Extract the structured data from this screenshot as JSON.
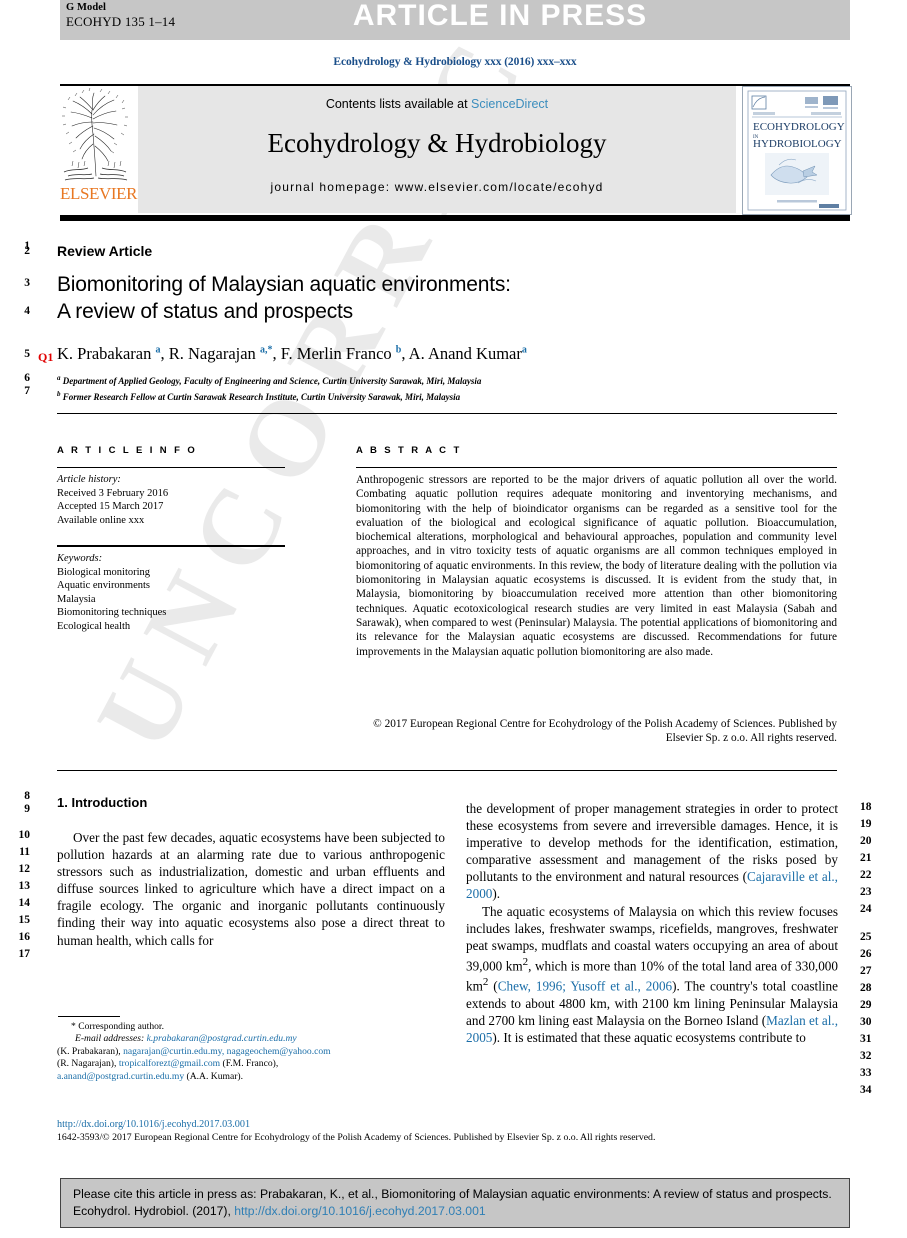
{
  "banner": {
    "g_model_line1": "G Model",
    "g_model_line2": "ECOHYD 135 1–14",
    "article_in_press": "ARTICLE IN PRESS"
  },
  "journal_ref": "Ecohydrology & Hydrobiology xxx (2016) xxx–xxx",
  "masthead": {
    "contents_prefix": "Contents lists available at ",
    "sciencedirect": "ScienceDirect",
    "journal_title": "Ecohydrology & Hydrobiology",
    "homepage": "journal homepage: www.elsevier.com/locate/ecohyd",
    "publisher_wordmark": "ELSEVIER",
    "cover_title_line1": "ECOHYDROLOGY",
    "cover_title_mid": "IN",
    "cover_title_line2": "HYDROBIOLOGY"
  },
  "article": {
    "type_label": "Review Article",
    "title_line1": "Biomonitoring of Malaysian aquatic environments:",
    "title_line2": "A review of status and prospects",
    "query_tag": "Q1",
    "authors_html": "K. Prabakaran <sup>a</sup>, R. Nagarajan <sup>a,*</sup>, F. Merlin Franco <sup>b</sup>, A. Anand Kumar<sup>a</sup>",
    "affiliation_a": "Department of Applied Geology, Faculty of Engineering and Science, Curtin University Sarawak, Miri, Malaysia",
    "affiliation_b": "Former Research Fellow at Curtin Sarawak Research Institute, Curtin University Sarawak, Miri, Malaysia"
  },
  "article_info": {
    "heading": "A R T I C L E   I N F O",
    "history_heading": "Article history:",
    "received": "Received 3 February 2016",
    "accepted": "Accepted 15 March 2017",
    "available": "Available online xxx",
    "keywords_heading": "Keywords:",
    "keywords": [
      "Biological monitoring",
      "Aquatic environments",
      "Malaysia",
      "Biomonitoring techniques",
      "Ecological health"
    ]
  },
  "abstract": {
    "heading": "A B S T R A C T",
    "text": "Anthropogenic stressors are reported to be the major drivers of aquatic pollution all over the world. Combating aquatic pollution requires adequate monitoring and inventorying mechanisms, and biomonitoring with the help of bioindicator organisms can be regarded as a sensitive tool for the evaluation of the biological and ecological significance of aquatic pollution. Bioaccumulation, biochemical alterations, morphological and behavioural approaches, population and community level approaches, and in vitro toxicity tests of aquatic organisms are all common techniques employed in biomonitoring of aquatic environments. In this review, the body of literature dealing with the pollution via biomonitoring in Malaysian aquatic ecosystems is discussed. It is evident from the study that, in Malaysia, biomonitoring by bioaccumulation received more attention than other biomonitoring techniques. Aquatic ecotoxicological research studies are very limited in east Malaysia (Sabah and Sarawak), when compared to west (Peninsular) Malaysia. The potential applications of biomonitoring and its relevance for the Malaysian aquatic ecosystems are discussed. Recommendations for future improvements in the Malaysian aquatic pollution biomonitoring are also made.",
    "copyright": "© 2017 European Regional Centre for Ecohydrology of the Polish Academy of Sciences. Published by Elsevier Sp. z o.o. All rights reserved."
  },
  "body": {
    "section_heading": "1. Introduction",
    "left_paragraph_1": "Over the past few decades, aquatic ecosystems have been subjected to pollution hazards at an alarming rate due to various anthropogenic stressors such as industrialization, domestic and urban effluents and diffuse sources linked to agriculture which have a direct impact on a fragile ecology. The organic and inorganic pollutants continuously finding their way into aquatic ecosystems also pose a direct threat to human health, which calls for",
    "right_paragraph_1_pre": "the development of proper management strategies in order to protect these ecosystems from severe and irreversible damages. Hence, it is imperative to develop methods for the identification, estimation, comparative assessment and management of the risks posed by pollutants to the environment and natural resources (",
    "right_paragraph_1_ref": "Cajaraville et al., 2000",
    "right_paragraph_1_post": ").",
    "right_paragraph_2_a": "The aquatic ecosystems of Malaysia on which this review focuses includes lakes, freshwater swamps, ricefields, mangroves, freshwater peat swamps, mudflats and coastal waters occupying an area of about 39,000 km",
    "right_paragraph_2_b": ", which is more than 10% of the total land area of 330,000 km",
    "right_paragraph_2_ref1": "Chew, 1996; Yusoff et al., 2006",
    "right_paragraph_2_c": "). The country's total coastline extends to about 4800 km, with 2100 km lining Peninsular Malaysia and 2700 km lining east Malaysia on the Borneo Island (",
    "right_paragraph_2_ref2": "Mazlan et al., 2005",
    "right_paragraph_2_d": "). It is estimated that these aquatic ecosystems contribute to"
  },
  "line_numbers_left": [
    "1",
    "2",
    "3",
    "4",
    "5",
    "6",
    "7",
    "8",
    "9",
    "10",
    "11",
    "12",
    "13",
    "14",
    "15",
    "16",
    "17"
  ],
  "line_numbers_right": [
    "18",
    "19",
    "20",
    "21",
    "22",
    "23",
    "24",
    "25",
    "26",
    "27",
    "28",
    "29",
    "30",
    "31",
    "32",
    "33",
    "34"
  ],
  "footnotes": {
    "corresponding": "* Corresponding author.",
    "emails_heading": "E-mail addresses:",
    "email_1": "k.prabakaran@postgrad.curtin.edu.my",
    "name_1": "(K. Prabakaran),",
    "email_2": "nagarajan@curtin.edu.my,",
    "email_3": "nagageochem@yahoo.com",
    "name_2": "(R. Nagarajan),",
    "email_4": "tropicalforezt@gmail.com",
    "name_3": "(F.M. Franco),",
    "email_5": "a.anand@postgrad.curtin.edu.my",
    "name_4": "(A.A. Kumar)."
  },
  "doi": "http://dx.doi.org/10.1016/j.ecohyd.2017.03.001",
  "issn_line": "1642-3593/© 2017 European Regional Centre for Ecohydrology of the Polish Academy of Sciences. Published by Elsevier Sp. z o.o. All rights reserved.",
  "cite_box": {
    "text_pre": "Please cite this article in press as: Prabakaran, K., et al., Biomonitoring of Malaysian aquatic environments: A review of status and prospects. Ecohydrol. Hydrobiol. (2017), ",
    "link": "http://dx.doi.org/10.1016/j.ecohyd.2017.03.001"
  },
  "watermark": "UNCORRECTED PROOF",
  "colors": {
    "banner_gray": "#c6c6c6",
    "masthead_gray": "#e6e6e6",
    "link_blue": "#1b6ea8",
    "journal_ref_blue": "#1b4f8a",
    "elsevier_orange": "#e87722",
    "query_red": "#e00000"
  }
}
